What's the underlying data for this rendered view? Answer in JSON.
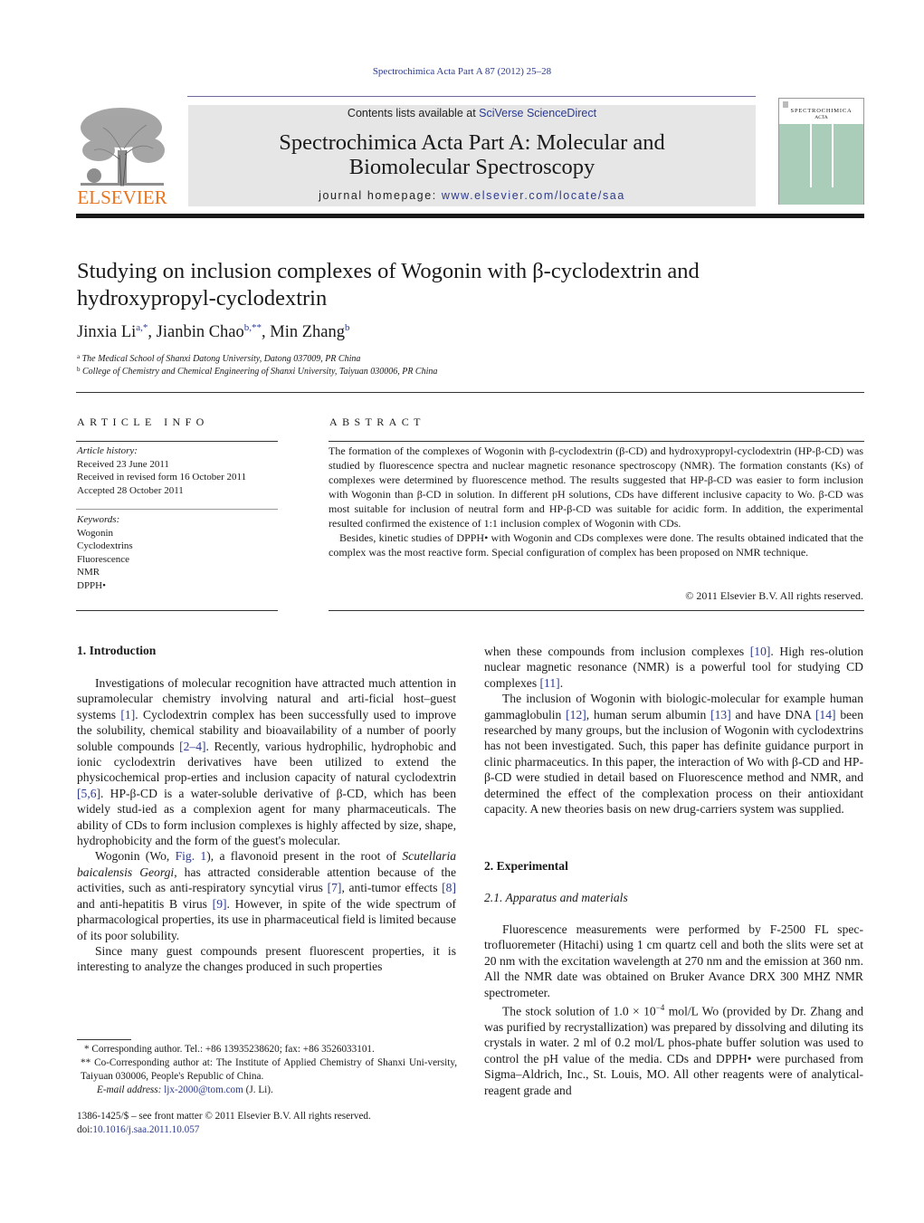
{
  "running_head": "Spectrochimica Acta Part A 87 (2012) 25–28",
  "masthead": {
    "publisher_logo_text": "ELSEVIER",
    "contents_prefix": "Contents lists available at ",
    "contents_link": "SciVerse ScienceDirect",
    "journal_title_line1": "Spectrochimica Acta Part A: Molecular and",
    "journal_title_line2": "Biomolecular Spectroscopy",
    "homepage_prefix": "journal homepage: ",
    "homepage_link": "www.elsevier.com/locate/saa",
    "cover_title": "SPECTROCHIMICA",
    "cover_subtitle": "ACTA"
  },
  "article": {
    "title_line1": "Studying on inclusion complexes of Wogonin with β-cyclodextrin and",
    "title_line2": "hydroxypropyl-cyclodextrin",
    "authors": [
      {
        "name": "Jinxia Li",
        "marks": "a,*"
      },
      {
        "name": "Jianbin Chao",
        "marks": "b,**"
      },
      {
        "name": "Min Zhang",
        "marks": "b"
      }
    ],
    "affiliations": [
      {
        "mark": "a",
        "text": "The Medical School of Shanxi Datong University, Datong 037009, PR China"
      },
      {
        "mark": "b",
        "text": "College of Chemistry and Chemical Engineering of Shanxi University, Taiyuan 030006, PR China"
      }
    ]
  },
  "article_info": {
    "heading": "ARTICLE INFO",
    "history_label": "Article history:",
    "history": [
      "Received 23 June 2011",
      "Received in revised form 16 October 2011",
      "Accepted 28 October 2011"
    ],
    "keywords_label": "Keywords:",
    "keywords": [
      "Wogonin",
      "Cyclodextrins",
      "Fluorescence",
      "NMR",
      "DPPH•"
    ]
  },
  "abstract": {
    "heading": "ABSTRACT",
    "paragraph1": "The formation of the complexes of Wogonin with β-cyclodextrin (β-CD) and hydroxypropyl-cyclodextrin (HP-β-CD) was studied by fluorescence spectra and nuclear magnetic resonance spectroscopy (NMR). The formation constants (Ks) of complexes were determined by fluorescence method. The results suggested that HP-β-CD was easier to form inclusion with Wogonin than β-CD in solution. In different pH solutions, CDs have different inclusive capacity to Wo. β-CD was most suitable for inclusion of neutral form and HP-β-CD was suitable for acidic form. In addition, the experimental resulted confirmed the existence of 1:1 inclusion complex of Wogonin with CDs.",
    "paragraph2": "Besides, kinetic studies of DPPH• with Wogonin and CDs complexes were done. The results obtained indicated that the complex was the most reactive form. Special configuration of complex has been proposed on NMR technique.",
    "copyright": "© 2011 Elsevier B.V. All rights reserved."
  },
  "sections": {
    "intro_heading": "1.  Introduction",
    "intro": {
      "p1_a": "Investigations of molecular recognition have attracted much attention in supramolecular chemistry involving natural and arti-ficial host–guest systems ",
      "ref1": "[1]",
      "p1_b": ". Cyclodextrin complex has been successfully used to improve the solubility, chemical stability and bioavailability of a number of poorly soluble compounds ",
      "ref2": "[2–4]",
      "p1_c": ". Recently, various hydrophilic, hydrophobic and ionic cyclodextrin derivatives have been utilized to extend the physicochemical prop-erties and inclusion capacity of natural cyclodextrin ",
      "ref3": "[5,6]",
      "p1_d": ". HP-β-CD is a water-soluble derivative of β-CD, which has been widely stud-ied as a complexion agent for many pharmaceuticals. The ability of CDs to form inclusion complexes is highly affected by size, shape, hydrophobicity and the form of the guest's molecular.",
      "p2_a": "Wogonin (Wo, ",
      "fig_ref": "Fig. 1",
      "p2_b": "), a flavonoid present in the root of ",
      "species": "Scutellaria baicalensis Georgi",
      "p2_c": ", has attracted considerable attention because of the activities, such as anti-respiratory syncytial virus ",
      "ref7": "[7]",
      "p2_d": ", anti-tumor effects ",
      "ref8": "[8]",
      "p2_e": " and anti-hepatitis B virus ",
      "ref9": "[9]",
      "p2_f": ". However, in spite of the wide spectrum of pharmacological properties, its use in pharmaceutical field is limited because of its poor solubility.",
      "p3": "Since many guest compounds present fluorescent properties, it is interesting to analyze the changes produced in such properties",
      "r1_a": "when these compounds from inclusion complexes ",
      "ref10": "[10]",
      "r1_b": ". High res-olution nuclear magnetic resonance (NMR) is a powerful tool for studying CD complexes ",
      "ref11": "[11]",
      "r1_c": ".",
      "r2_a": "The inclusion of Wogonin with biologic-molecular for example human gammaglobulin ",
      "ref12": "[12]",
      "r2_b": ", human serum albumin ",
      "ref13": "[13]",
      "r2_c": " and have DNA ",
      "ref14": "[14]",
      "r2_d": " been researched by many groups, but the inclusion of Wogonin with cyclodextrins has not been investigated. Such, this paper has definite guidance purport in clinic pharmaceutics. In this paper, the interaction of Wo with β-CD and HP-β-CD were studied in detail based on Fluorescence method and NMR, and determined the effect of the complexation process on their antioxidant capacity. A new theories basis on new drug-carriers system was supplied."
    },
    "experimental_heading": "2.  Experimental",
    "apparatus_heading": "2.1.  Apparatus and materials",
    "experimental": {
      "p1": "Fluorescence measurements were performed by F-2500 FL spec-trofluoremeter (Hitachi) using 1 cm quartz cell and both the slits were set at 20 nm with the excitation wavelength at 270 nm and the emission at 360 nm. All the NMR date was obtained on Bruker Avance DRX 300 MHZ NMR spectrometer.",
      "p2_a": "The stock solution of 1.0 × 10",
      "p2_exp": "−4",
      "p2_b": " mol/L Wo (provided by Dr. Zhang and was purified by recrystallization) was prepared by dissolving and diluting its crystals in water. 2 ml of 0.2 mol/L phos-phate buffer solution was used to control the pH value of the media. CDs and DPPH• were purchased from Sigma–Aldrich, Inc., St. Louis, MO. All other reagents were of analytical-reagent grade and"
    }
  },
  "footnotes": {
    "fn1": "* Corresponding author. Tel.: +86 13935238620; fax: +86 3526033101.",
    "fn2": "** Co-Corresponding author at: The Institute of Applied Chemistry of Shanxi Uni-versity, Taiyuan 030006, People's Republic of China.",
    "email_label": "E-mail address: ",
    "email": "ljx-2000@tom.com",
    "email_suffix": " (J. Li).",
    "issn_line": "1386-1425/$ – see front matter © 2011 Elsevier B.V. All rights reserved.",
    "doi_prefix": "doi:",
    "doi": "10.1016/j.saa.2011.10.057"
  },
  "colors": {
    "link": "#2b3a8f",
    "elsevier_orange": "#e9751f",
    "masthead_bg": "#e6e6e6",
    "cover_green": "#a9cdb8"
  }
}
